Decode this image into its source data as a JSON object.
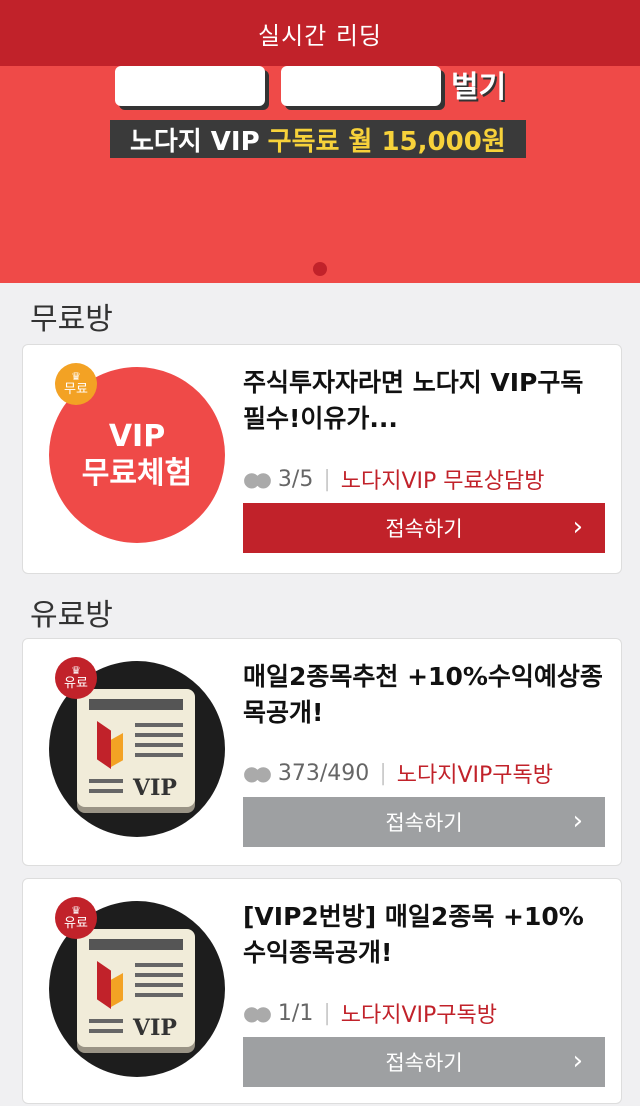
{
  "header": {
    "title": "실시간 리딩"
  },
  "banner": {
    "big_suffix": "벌기",
    "sub_prefix": "노다지 VIP",
    "sub_highlight": "구독료 월 15,000원"
  },
  "sections": {
    "free_title": "무료방",
    "paid_title": "유료방"
  },
  "rooms": [
    {
      "badge": "무료",
      "thumb_line1": "VIP",
      "thumb_line2": "무료체험",
      "title": "주식투자자라면 노다지 VIP구독필수!이유가...",
      "count": "3/5",
      "room_name": "노다지VIP 무료상담방",
      "button": "접속하기"
    },
    {
      "badge": "유료",
      "thumb_text": "VIP",
      "title": "매일2종목추천 +10%수익예상종목공개!",
      "count": "373/490",
      "room_name": "노다지VIP구독방",
      "button": "접속하기"
    },
    {
      "badge": "유료",
      "thumb_text": "VIP",
      "title": "[VIP2번방] 매일2종목 +10% 수익종목공개!",
      "count": "1/1",
      "room_name": "노다지VIP구독방",
      "button": "접속하기"
    }
  ],
  "colors": {
    "accent": "#c1222a",
    "banner": "#ef4a48",
    "disabled": "#9ea0a2"
  },
  "icons": {
    "people": "people-icon",
    "chevron": "chevron-right-icon",
    "crown": "crown-icon"
  }
}
